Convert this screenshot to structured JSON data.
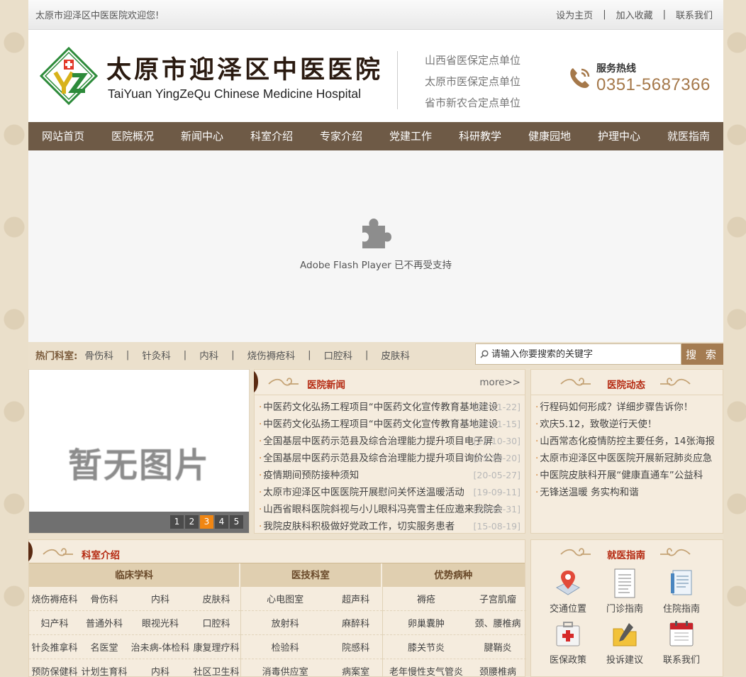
{
  "topbar": {
    "welcome": "太原市迎泽区中医医院欢迎您!",
    "links": [
      "设为主页",
      "加入收藏",
      "联系我们"
    ],
    "separator": "|"
  },
  "header": {
    "logo_cn": "太原市迎泽区中医医院",
    "logo_en": "TaiYuan YingZeQu Chinese Medicine Hospital",
    "certs": [
      "山西省医保定点单位",
      "太原市医保定点单位",
      "省市新农合定点单位"
    ],
    "hotline_label": "服务热线",
    "hotline_number": "0351-5687366"
  },
  "nav": [
    "网站首页",
    "医院概况",
    "新闻中心",
    "科室介绍",
    "专家介绍",
    "党建工作",
    "科研教学",
    "健康园地",
    "护理中心",
    "就医指南"
  ],
  "flash": {
    "message": "Adobe Flash Player 已不再受支持"
  },
  "hot": {
    "title": "热门科室:",
    "items": [
      "骨伤科",
      "针灸科",
      "内科",
      "烧伤褥疮科",
      "口腔科",
      "皮肤科"
    ],
    "separator": "|"
  },
  "search": {
    "placeholder": "请输入你要搜索的关键字",
    "button": "搜 索"
  },
  "gallery": {
    "placeholder": "暂无图片",
    "pages": [
      "1",
      "2",
      "3",
      "4",
      "5"
    ],
    "active_page": "3"
  },
  "news": {
    "title": "医院新闻",
    "more": "more>>",
    "items": [
      {
        "text": "中医药文化弘扬工程项目“中医药文化宣传教育基地建设",
        "date": "[23-11-22]"
      },
      {
        "text": "中医药文化弘扬工程项目“中医药文化宣传教育基地建设",
        "date": "[23-11-15]"
      },
      {
        "text": "全国基层中医药示范县及综合治理能力提升项目电子屏",
        "date": "[23-10-30]"
      },
      {
        "text": "全国基层中医药示范县及综合治理能力提升项目询价公告",
        "date": "[23-10-20]"
      },
      {
        "text": "疫情期间预防接种须知",
        "date": "[20-05-27]"
      },
      {
        "text": "太原市迎泽区中医医院开展慰问关怀送温暖活动",
        "date": "[19-09-11]"
      },
      {
        "text": "山西省眼科医院斜视与小儿眼科冯亮雪主任应邀来我院会",
        "date": "[15-12-31]"
      },
      {
        "text": "我院皮肤科积极做好党政工作，切实服务患者",
        "date": "[15-08-19]"
      }
    ]
  },
  "dynamics": {
    "title": "医院动态",
    "items": [
      "行程码如何形成？详细步骤告诉你！",
      "欢庆5.12，致敬逆行天使！",
      "山西常态化疫情防控主要任务，14张海报",
      "太原市迎泽区中医医院开展新冠肺炎应急",
      "中医院皮肤科开展“健康直通车”公益科",
      "无锋送温暖 务实构和谐"
    ]
  },
  "departments": {
    "title": "科室介绍",
    "headers": [
      "临床学科",
      "医技科室",
      "优势病种"
    ],
    "clinical": [
      [
        "烧伤褥疮科",
        "骨伤科",
        "内科",
        "皮肤科"
      ],
      [
        "妇产科",
        "普通外科",
        "眼视光科",
        "口腔科"
      ],
      [
        "针灸推拿科",
        "名医堂",
        "治未病-体检科",
        "康复理疗科"
      ],
      [
        "预防保健科",
        "计划生育科",
        "内科",
        "社区卫生科"
      ]
    ],
    "medtech": [
      [
        "心电图室",
        "超声科"
      ],
      [
        "放射科",
        "麻醉科"
      ],
      [
        "检验科",
        "院感科"
      ],
      [
        "消毒供应室",
        "病案室"
      ]
    ],
    "diseases": [
      [
        "褥疮",
        "子宫肌瘤"
      ],
      [
        "卵巢囊肿",
        "颈、腰椎病"
      ],
      [
        "膝关节炎",
        "腱鞘炎"
      ],
      [
        "老年慢性支气管炎",
        "颈腰椎病"
      ]
    ]
  },
  "guide": {
    "title": "就医指南",
    "items": [
      {
        "label": "交通位置",
        "icon": "map-pin-icon"
      },
      {
        "label": "门诊指南",
        "icon": "document-icon"
      },
      {
        "label": "住院指南",
        "icon": "clipboard-icon"
      },
      {
        "label": "医保政策",
        "icon": "first-aid-icon"
      },
      {
        "label": "投诉建议",
        "icon": "folder-pen-icon"
      },
      {
        "label": "联系我们",
        "icon": "calendar-icon"
      }
    ]
  },
  "colors": {
    "nav_bg": "#6e5a46",
    "accent_red": "#b52a12",
    "hotline": "#a5784a",
    "pager_active": "#f08613",
    "search_button": "#a47c52"
  }
}
